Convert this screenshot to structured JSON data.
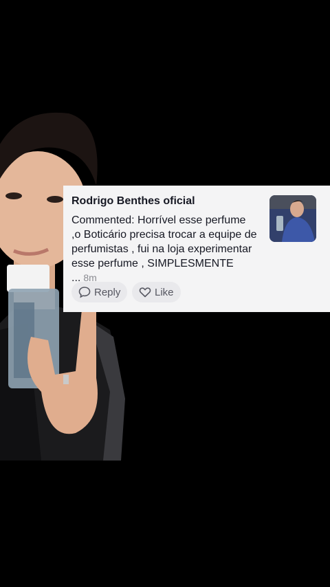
{
  "comment": {
    "author": "Rodrigo Benthes oficial",
    "text": "Commented: Horrível esse perfume ,o Boticário precisa trocar a equipe de perfumistas , fui na loja experimentar esse perfume , SIMPLESMENTE ...",
    "time": "8m",
    "reply_label": "Reply",
    "like_label": "Like"
  },
  "icons": {
    "reply": "speech-bubble-icon",
    "like": "heart-icon"
  },
  "colors": {
    "background": "#000000",
    "card": "#f4f4f5",
    "text": "#161823",
    "muted": "#8a8b91"
  }
}
